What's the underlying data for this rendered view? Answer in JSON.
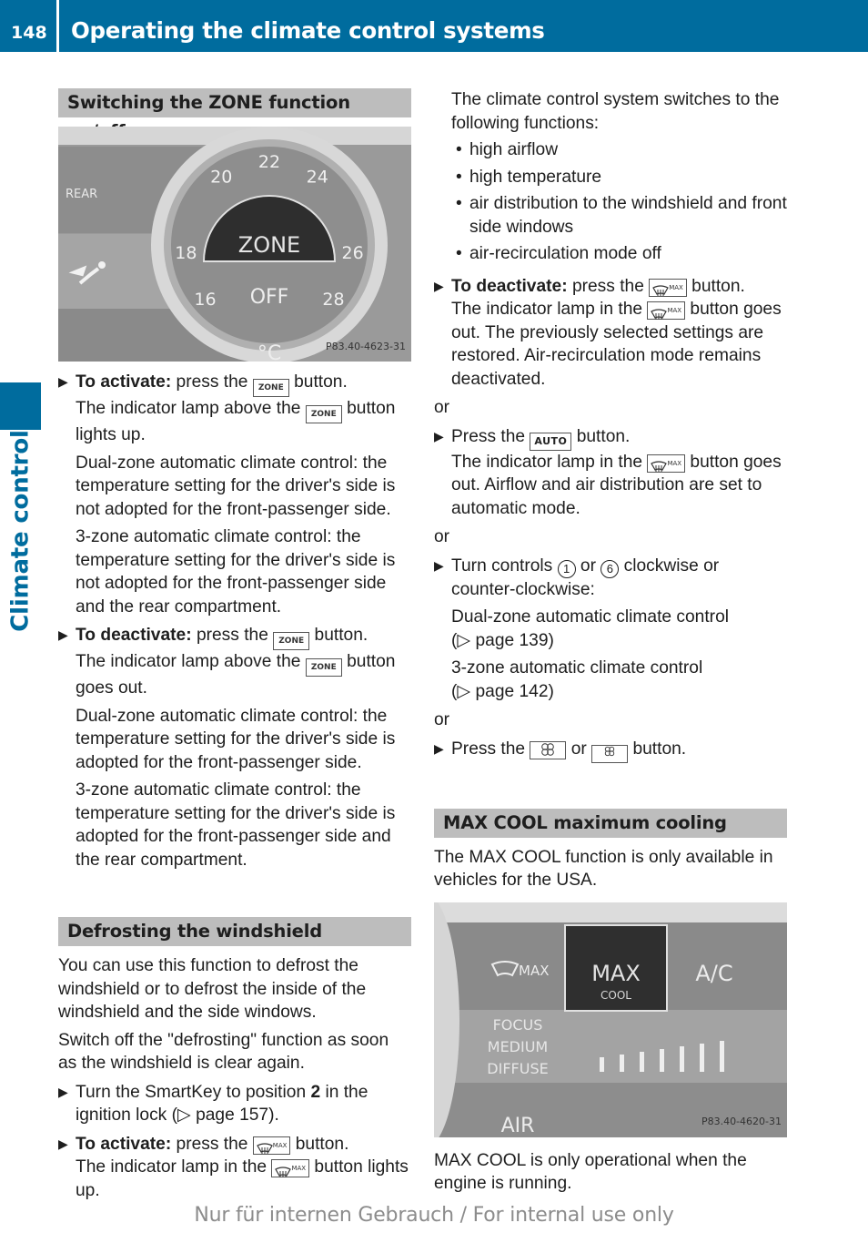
{
  "header": {
    "page_number": "148",
    "title": "Operating the climate control systems"
  },
  "side_tab": {
    "label": "Climate control",
    "color": "#006c9e"
  },
  "left": {
    "zone_section": {
      "heading": "Switching the ZONE function on/off",
      "figure": {
        "id": "P83.40-4623-31",
        "dial_labels": [
          "16",
          "18",
          "20",
          "22",
          "24",
          "26",
          "28"
        ],
        "center_label": "ZONE",
        "off_label": "OFF",
        "unit_label": "°C",
        "side_label": "REAR"
      },
      "activate": {
        "lead": "To activate:",
        "text1": " press the ",
        "key": "ZONE",
        "text2": " button.",
        "line2a": "The indicator lamp above the ",
        "line2b": " button lights up.",
        "dual": "Dual-zone automatic climate control: the temperature setting for the driver's side is not adopted for the front-passenger side.",
        "three": "3-zone automatic climate control: the temperature setting for the driver's side is not adopted for the front-passenger side and the rear compartment."
      },
      "deactivate": {
        "lead": "To deactivate:",
        "text1": " press the ",
        "key": "ZONE",
        "text2": " button.",
        "line2a": "The indicator lamp above the ",
        "line2b": " button goes out.",
        "dual": "Dual-zone automatic climate control: the temperature setting for the driver's side is adopted for the front-passenger side.",
        "three": "3-zone automatic climate control: the temperature setting for the driver's side is adopted for the front-passenger side and the rear compartment."
      }
    },
    "defrost_section": {
      "heading": "Defrosting the windshield",
      "para1": "You can use this function to defrost the windshield or to defrost the inside of the windshield and the side windows.",
      "para2": "Switch off the \"defrosting\" function as soon as the windshield is clear again.",
      "step1": {
        "text1": "Turn the SmartKey to position ",
        "bold": "2",
        "text2": " in the ignition lock (",
        "ref": "▷ page 157",
        "text3": ")."
      },
      "step2": {
        "lead": "To activate:",
        "text1": " press the ",
        "text2": " button.",
        "line2a": "The indicator lamp in the ",
        "line2b": " button lights up."
      }
    }
  },
  "right": {
    "intro": "The climate control system switches to the following functions:",
    "bullets": [
      "high airflow",
      "high temperature",
      "air distribution to the windshield and front side windows",
      "air-recirculation mode off"
    ],
    "deactivate": {
      "lead": "To deactivate:",
      "text1": " press the ",
      "text2": " button.",
      "line2a": "The indicator lamp in the ",
      "line2b": " button goes out. The previously selected settings are restored. Air-recirculation mode remains deactivated."
    },
    "or": "or",
    "auto_step": {
      "text1": "Press the ",
      "key": "AUTO",
      "text2": " button.",
      "line2a": "The indicator lamp in the ",
      "line2b": " button goes out. Airflow and air distribution are set to automatic mode."
    },
    "turn_step": {
      "text1": "Turn controls ",
      "ctrl1": "1",
      "text2": " or ",
      "ctrl2": "6",
      "text3": " clockwise or counter-clockwise:",
      "dual": "Dual-zone automatic climate control",
      "dual_ref": "(▷ page 139)",
      "three": "3-zone automatic climate control",
      "three_ref": "(▷ page 142)"
    },
    "fan_step": {
      "text1": "Press the ",
      "text2": " or ",
      "text3": " button."
    },
    "maxcool_section": {
      "heading": "MAX COOL maximum cooling",
      "para1": "The MAX COOL function is only available in vehicles for the USA.",
      "figure": {
        "id": "P83.40-4620-31",
        "btn_defrost": "MAX",
        "btn_maxcool_1": "MAX",
        "btn_maxcool_2": "COOL",
        "btn_ac": "A/C",
        "modes": [
          "FOCUS",
          "MEDIUM",
          "DIFFUSE"
        ],
        "air_flow": "AIR"
      },
      "para2": "MAX COOL is only operational when the engine is running."
    }
  },
  "footer": "Nur für internen Gebrauch / For internal use only"
}
